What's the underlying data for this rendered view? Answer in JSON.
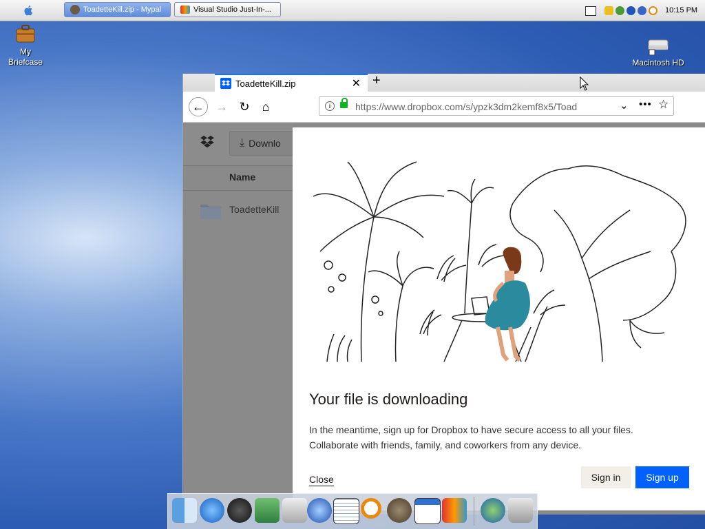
{
  "taskbar": {
    "tasks": [
      {
        "label": "ToadetteKill.zip - Mypal"
      },
      {
        "label": "Visual Studio Just-In-..."
      }
    ],
    "clock": "10:15 PM"
  },
  "desktop": {
    "icons": [
      {
        "label": "My Briefcase"
      },
      {
        "label": "Macintosh HD"
      }
    ]
  },
  "browser": {
    "tab_title": "ToadetteKill.zip",
    "url": "https://www.dropbox.com/s/ypzk3dm2kemf8x5/Toad"
  },
  "page": {
    "download_label": "Downlo",
    "column_name": "Name",
    "folder_name": "ToadetteKill"
  },
  "modal": {
    "title": "Your file is downloading",
    "description": "In the meantime, sign up for Dropbox to have secure access to all your files. Collaborate with friends, family, and coworkers from any device.",
    "close_label": "Close",
    "signin_label": "Sign in",
    "signup_label": "Sign up"
  },
  "colors": {
    "dropbox_blue": "#0061fe",
    "dress_teal": "#2a8a9e",
    "desktop_blue": "#2d5cb4"
  },
  "dock": {
    "icons": [
      "finder-icon",
      "safari-icon",
      "itunes-icon",
      "iphoto-icon",
      "system-preferences-icon",
      "feather-icon",
      "graph-icon",
      "search-icon",
      "raccoon-icon",
      "window-icon",
      "app-icon",
      "globe-icon",
      "trash-icon"
    ]
  }
}
